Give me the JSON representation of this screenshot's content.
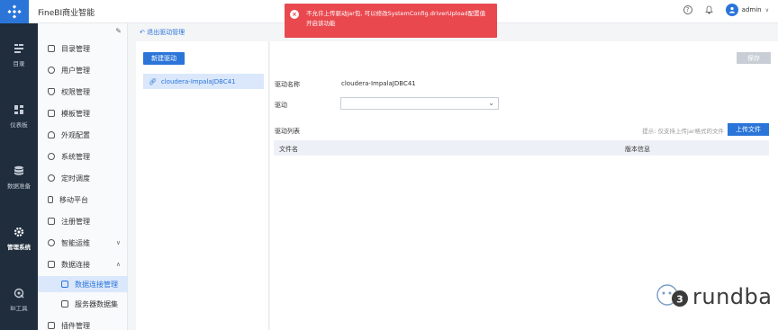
{
  "app": {
    "title": "FineBI商业智能",
    "admin": "admin"
  },
  "rail": [
    {
      "label": "目录",
      "icon": "catalog-icon",
      "active": false
    },
    {
      "label": "仪表板",
      "icon": "dashboard-icon",
      "active": false
    },
    {
      "label": "数据准备",
      "icon": "database-icon",
      "active": false
    },
    {
      "label": "管理系统",
      "icon": "gear-icon",
      "active": true
    },
    {
      "label": "BI工具",
      "icon": "tool-icon",
      "active": false
    }
  ],
  "menu": [
    {
      "label": "目录管理",
      "icon": "catalog-mgmt-icon"
    },
    {
      "label": "用户管理",
      "icon": "user-icon"
    },
    {
      "label": "权限管理",
      "icon": "shield-icon"
    },
    {
      "label": "模板管理",
      "icon": "template-icon"
    },
    {
      "label": "外观配置",
      "icon": "appearance-icon"
    },
    {
      "label": "系统管理",
      "icon": "settings-icon"
    },
    {
      "label": "定时调度",
      "icon": "clock-icon"
    },
    {
      "label": "移动平台",
      "icon": "mobile-icon"
    },
    {
      "label": "注册管理",
      "icon": "register-icon"
    },
    {
      "label": "智能运维",
      "icon": "ops-icon",
      "chevron": "∨"
    },
    {
      "label": "数据连接",
      "icon": "connection-icon",
      "chevron": "∧"
    },
    {
      "label": "数据连接管理",
      "icon": "connection-mgmt-icon",
      "child": true,
      "selected": true
    },
    {
      "label": "服务器数据集",
      "icon": "server-dataset-icon",
      "child": true
    },
    {
      "label": "插件管理",
      "icon": "plugin-icon"
    }
  ],
  "back_link": "退出驱动管理",
  "new_driver_button": "新建驱动",
  "driver_item": "cloudera-ImpalaJDBC41",
  "save_button": "保存",
  "driver_name_label": "驱动名称",
  "driver_name_value": "cloudera-ImpalaJDBC41",
  "driver_label": "驱动",
  "driver_select_value": "",
  "driver_list_label": "驱动列表",
  "hint": "提示: 仅支持上传jar格式的文件",
  "upload_button": "上传文件",
  "table": {
    "col_file": "文件名",
    "col_version": "版本信息"
  },
  "toast": {
    "line1": "不允许上传驱动jar包, 可以修改SystemConfig.driverUpload配置值",
    "line2": "开启该功能"
  },
  "watermark": "rundba",
  "colors": {
    "primary": "#2b75d9",
    "rail": "#1f2d3d",
    "error": "#e9484f"
  }
}
